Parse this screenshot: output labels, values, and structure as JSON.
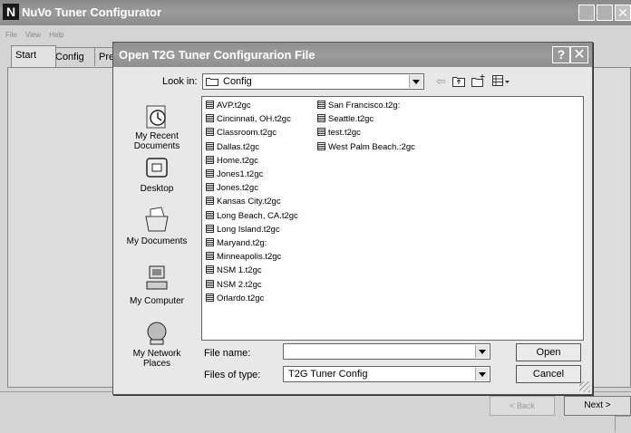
{
  "app": {
    "logo_letter": "N",
    "title": "NuVo Tuner Configurator"
  },
  "menu": [
    "File",
    "View",
    "Help"
  ],
  "tabs": [
    "Start",
    "Config",
    "Prese"
  ],
  "nav_buttons": {
    "back": "< Back",
    "next": "Next >"
  },
  "dialog": {
    "title": "Open T2G Tuner Configurarion File",
    "help_label": "?",
    "close_label": "✕",
    "look_in_label": "Look in:",
    "look_in_value": "Config",
    "places": [
      {
        "label": "My Recent Documents",
        "icon": "recent-documents-icon"
      },
      {
        "label": "Desktop",
        "icon": "desktop-icon"
      },
      {
        "label": "My Documents",
        "icon": "my-documents-icon"
      },
      {
        "label": "My Computer",
        "icon": "my-computer-icon"
      },
      {
        "label": "My Network Places",
        "icon": "network-places-icon"
      }
    ],
    "files_col1": [
      "AVP.t2gc",
      "Cincinnati, OH.t2gc",
      "Classroom.t2gc",
      "Dallas.t2gc",
      "Home.t2gc",
      "Jones1.t2gc",
      "Jones.t2gc",
      "Kansas City.t2gc",
      "Long Beach, CA.t2gc",
      "Long Island.t2gc",
      "Maryand.t2g:",
      "Minneapolis.t2gc",
      "NSM 1.t2gc",
      "NSM 2.t2gc",
      "Orlardo.t2gc"
    ],
    "files_col2": [
      "San Francisco.t2g:",
      "Seattle.t2gc",
      "test.t2gc",
      "West Palm Beach.:2gc"
    ],
    "file_name_label": "File name:",
    "file_name_value": "",
    "files_of_type_label": "Files of type:",
    "files_of_type_value": "T2G Tuner Config",
    "open_label": "Open",
    "cancel_label": "Cancel"
  }
}
